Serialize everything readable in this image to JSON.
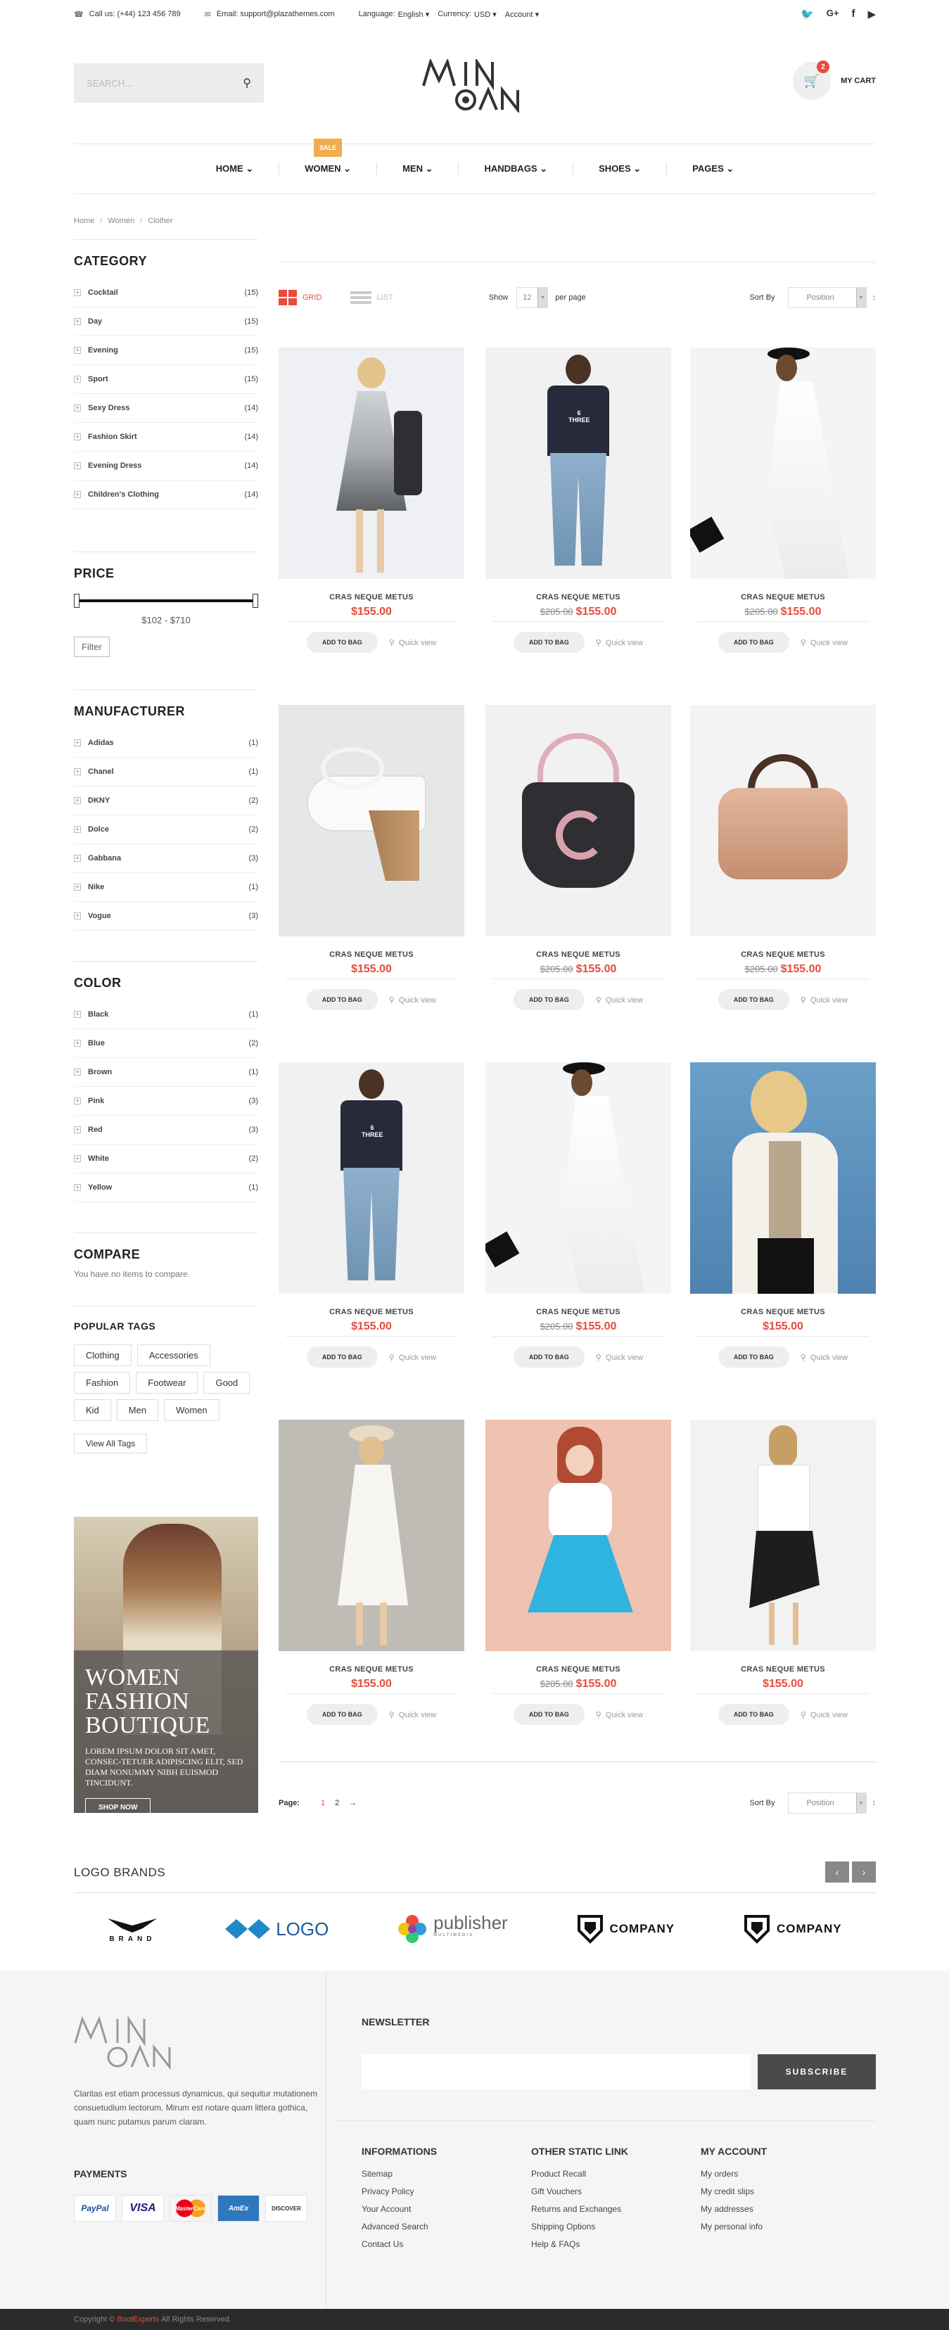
{
  "topbar": {
    "phone": "Call us: (+44) 123 456 789",
    "email": "Email: support@plazathemes.com",
    "language_label": "Language:",
    "language": "English",
    "currency_label": "Currency:",
    "currency": "USD",
    "account": "Account",
    "social": [
      "twitter-icon",
      "google-plus-icon",
      "facebook-icon",
      "youtube-icon"
    ]
  },
  "header": {
    "search_placeholder": "SEARCH...",
    "cart_count": "2",
    "cart_label": "MY CART"
  },
  "nav": {
    "items": [
      {
        "label": "HOME"
      },
      {
        "label": "WOMEN",
        "badge": "SALE"
      },
      {
        "label": "MEN"
      },
      {
        "label": "HANDBAGS"
      },
      {
        "label": "SHOES"
      },
      {
        "label": "PAGES"
      }
    ]
  },
  "breadcrumb": [
    "Home",
    "Women",
    "Clother"
  ],
  "category": {
    "title": "CATEGORY",
    "items": [
      {
        "label": "Cocktail",
        "count": "(15)"
      },
      {
        "label": "Day",
        "count": "(15)"
      },
      {
        "label": "Evening",
        "count": "(15)"
      },
      {
        "label": "Sport",
        "count": "(15)"
      },
      {
        "label": "Sexy Dress",
        "count": "(14)"
      },
      {
        "label": "Fashion Skirt",
        "count": "(14)"
      },
      {
        "label": "Evening Dress",
        "count": "(14)"
      },
      {
        "label": "Children's Clothing",
        "count": "(14)"
      }
    ]
  },
  "price": {
    "title": "PRICE",
    "range": "$102 - $710",
    "filter": "Filter"
  },
  "manufacturer": {
    "title": "MANUFACTURER",
    "items": [
      {
        "label": "Adidas",
        "count": "(1)"
      },
      {
        "label": "Chanel",
        "count": "(1)"
      },
      {
        "label": "DKNY",
        "count": "(2)"
      },
      {
        "label": "Dolce",
        "count": "(2)"
      },
      {
        "label": "Gabbana",
        "count": "(3)"
      },
      {
        "label": "Nike",
        "count": "(1)"
      },
      {
        "label": "Vogue",
        "count": "(3)"
      }
    ]
  },
  "color": {
    "title": "COLOR",
    "items": [
      {
        "label": "Black",
        "count": "(1)"
      },
      {
        "label": "Blue",
        "count": "(2)"
      },
      {
        "label": "Brown",
        "count": "(1)"
      },
      {
        "label": "Pink",
        "count": "(3)"
      },
      {
        "label": "Red",
        "count": "(3)"
      },
      {
        "label": "White",
        "count": "(2)"
      },
      {
        "label": "Yellow",
        "count": "(1)"
      }
    ]
  },
  "compare": {
    "title": "COMPARE",
    "text": "You have no items to compare."
  },
  "tags": {
    "title": "POPULAR TAGS",
    "items": [
      "Clothing",
      "Accessories",
      "Fashion",
      "Footwear",
      "Good",
      "Kid",
      "Men",
      "Women"
    ],
    "view_all": "View All Tags"
  },
  "banner": {
    "title": "WOMEN FASHION BOUTIQUE",
    "text": "LOREM IPSUM DOLOR SIT AMET, CONSEC-TETUER ADIPISCING ELIT, SED DIAM NONUMMY NIBH EUISMOD TINCIDUNT.",
    "button": "SHOP NOW"
  },
  "toolbar": {
    "grid": "GRID",
    "list": "LIST",
    "show": "Show",
    "per_page_value": "12",
    "per_page": "per page",
    "sort_by": "Sort By",
    "sort_value": "Position"
  },
  "products": [
    {
      "name": "CRAS NEQUE METUS",
      "price": "$155.00",
      "old": "",
      "add": "ADD TO BAG",
      "quick": "Quick view",
      "img": "grey-dress"
    },
    {
      "name": "CRAS NEQUE METUS",
      "price": "$155.00",
      "old": "$205.00",
      "add": "ADD TO BAG",
      "quick": "Quick view",
      "img": "tshirt-jeans"
    },
    {
      "name": "CRAS NEQUE METUS",
      "price": "$155.00",
      "old": "$205.00",
      "add": "ADD TO BAG",
      "quick": "Quick view",
      "img": "white-gown"
    },
    {
      "name": "CRAS NEQUE METUS",
      "price": "$155.00",
      "old": "",
      "add": "ADD TO BAG",
      "quick": "Quick view",
      "img": "wedge-sandal"
    },
    {
      "name": "CRAS NEQUE METUS",
      "price": "$155.00",
      "old": "$205.00",
      "add": "ADD TO BAG",
      "quick": "Quick view",
      "img": "black-handbag"
    },
    {
      "name": "CRAS NEQUE METUS",
      "price": "$155.00",
      "old": "$205.00",
      "add": "ADD TO BAG",
      "quick": "Quick view",
      "img": "tan-bag"
    },
    {
      "name": "CRAS NEQUE METUS",
      "price": "$155.00",
      "old": "",
      "add": "ADD TO BAG",
      "quick": "Quick view",
      "img": "tshirt-jeans"
    },
    {
      "name": "CRAS NEQUE METUS",
      "price": "$155.00",
      "old": "$205.00",
      "add": "ADD TO BAG",
      "quick": "Quick view",
      "img": "white-gown"
    },
    {
      "name": "CRAS NEQUE METUS",
      "price": "$155.00",
      "old": "",
      "add": "ADD TO BAG",
      "quick": "Quick view",
      "img": "blazer"
    },
    {
      "name": "CRAS NEQUE METUS",
      "price": "$155.00",
      "old": "",
      "add": "ADD TO BAG",
      "quick": "Quick view",
      "img": "boho-dress"
    },
    {
      "name": "CRAS NEQUE METUS",
      "price": "$155.00",
      "old": "$205.00",
      "add": "ADD TO BAG",
      "quick": "Quick view",
      "img": "blue-skirt"
    },
    {
      "name": "CRAS NEQUE METUS",
      "price": "$155.00",
      "old": "",
      "add": "ADD TO BAG",
      "quick": "Quick view",
      "img": "black-skirt"
    }
  ],
  "pager": {
    "label": "Page:",
    "pages": [
      "1",
      "2"
    ],
    "next": "→",
    "sort_by": "Sort By",
    "sort_value": "Position"
  },
  "brands": {
    "title": "LOGO BRANDS",
    "prev": "‹",
    "next": "›",
    "items": [
      "BRAND",
      "LOGO",
      "publisher",
      "COMPANY",
      "COMPANY"
    ],
    "publisher_sub": "MULTIMEDIA"
  },
  "footer": {
    "desc": "Claritas est etiam processus dynamicus, qui sequitur mutationem consuetudium lectorum. Mirum est notare quam littera gothica, quam nunc putamus parum claram.",
    "payments_title": "PAYMENTS",
    "payments": [
      "PayPal",
      "VISA",
      "MasterCard",
      "AmEx",
      "DISCOVER"
    ],
    "newsletter_title": "NEWSLETTER",
    "subscribe": "SUBSCRIBE",
    "cols": [
      {
        "title": "INFORMATIONS",
        "links": [
          "Sitemap",
          "Privacy Policy",
          "Your Account",
          "Advanced Search",
          "Contact Us"
        ]
      },
      {
        "title": "OTHER STATIC LINK",
        "links": [
          "Product Recall",
          "Gift Vouchers",
          "Returns and Exchanges",
          "Shipping Options",
          "Help & FAQs"
        ]
      },
      {
        "title": "MY ACCOUNT",
        "links": [
          "My orders",
          "My credit slips",
          "My addresses",
          "My personal info"
        ]
      }
    ],
    "copy_pre": "Copyright ©",
    "copy_brand": "BootExperts",
    "copy_post": "All Rights Reserved."
  },
  "colors": {
    "accent": "#e74c3c",
    "sale": "#f0ad4e",
    "dark": "#222222"
  }
}
